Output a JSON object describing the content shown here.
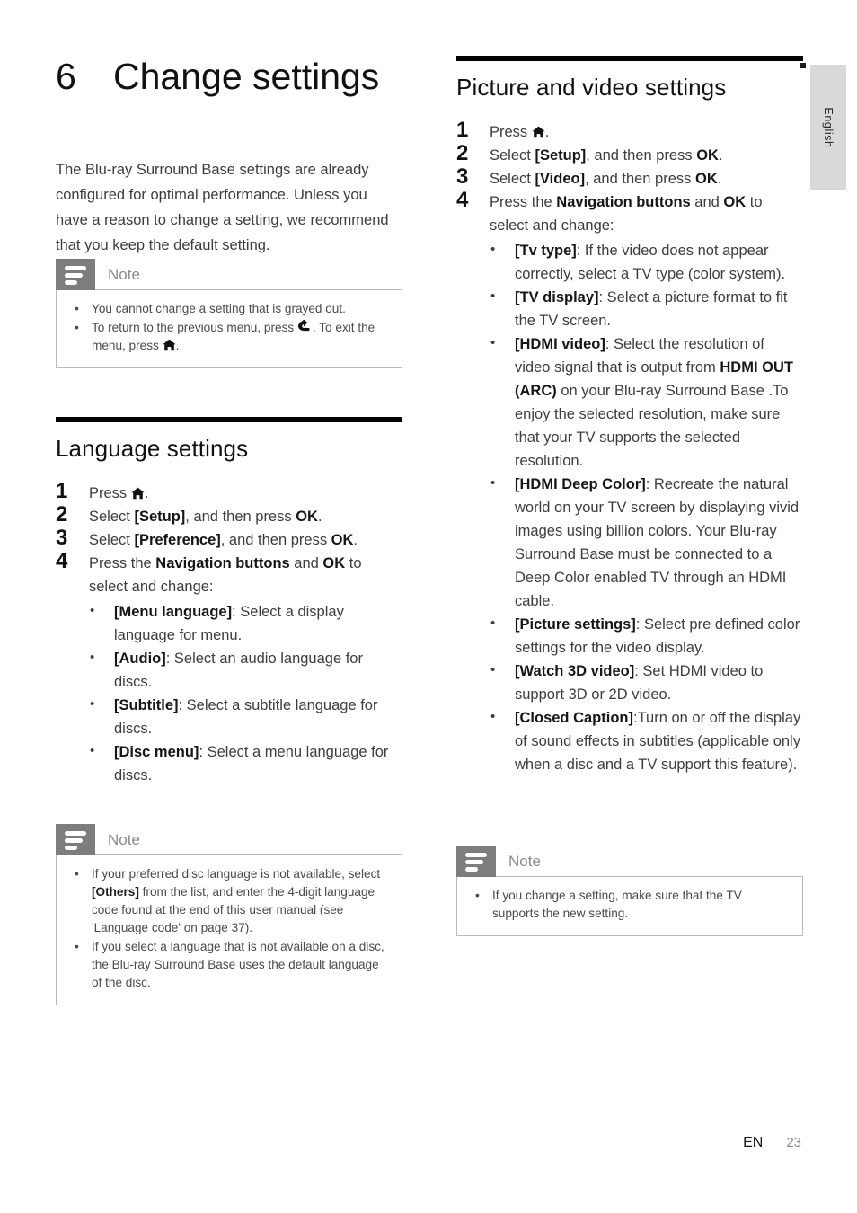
{
  "page": {
    "language_tab": "English",
    "footer_locale": "EN",
    "footer_page_number": "23"
  },
  "chapter": {
    "number": "6",
    "title": "Change settings",
    "intro": "The Blu-ray Surround Base  settings are already configured for optimal performance. Unless you have a reason to change a setting, we recommend that you keep the default setting."
  },
  "note_intro": {
    "label": "Note",
    "items": [
      {
        "pre": "You cannot change a setting that is grayed out.",
        "post": ""
      },
      {
        "pre": "To return to the previous menu, press ",
        "mid": ". To exit the menu, press ",
        "post": "."
      }
    ]
  },
  "language_section": {
    "title": "Language settings",
    "steps": [
      {
        "n": "1",
        "pre": "Press ",
        "post": "."
      },
      {
        "n": "2",
        "pre": "Select ",
        "bold": "[Setup]",
        "mid": ", and then press ",
        "bold2": "OK",
        "post": "."
      },
      {
        "n": "3",
        "pre": "Select ",
        "bold": "[Preference]",
        "mid": ", and then press ",
        "bold2": "OK",
        "post": "."
      },
      {
        "n": "4",
        "pre": "Press the ",
        "bold": "Navigation buttons",
        "mid": " and ",
        "bold2": "OK",
        "post": " to select and change:"
      }
    ],
    "bullets": [
      {
        "term": "[Menu language]",
        "text": ": Select a display language for menu."
      },
      {
        "term": "[Audio]",
        "text": ": Select an audio language for discs."
      },
      {
        "term": "[Subtitle]",
        "text": ": Select a subtitle language for discs."
      },
      {
        "term": "[Disc menu]",
        "text": ": Select a menu language for discs."
      }
    ]
  },
  "note_language": {
    "label": "Note",
    "items": [
      {
        "pre": "If your preferred disc language is not available, select ",
        "bold": "[Others]",
        "post": " from the list, and enter the 4-digit language code found at the end of this user manual (see 'Language code' on page 37)."
      },
      {
        "pre": "If you select a language that is not available on a disc, the Blu-ray Surround Base  uses the default language of the disc.",
        "post": ""
      }
    ]
  },
  "picture_section": {
    "title": "Picture and video settings",
    "steps": [
      {
        "n": "1",
        "pre": "Press ",
        "post": "."
      },
      {
        "n": "2",
        "pre": "Select ",
        "bold": "[Setup]",
        "mid": ", and then press ",
        "bold2": "OK",
        "post": "."
      },
      {
        "n": "3",
        "pre": "Select ",
        "bold": "[Video]",
        "mid": ", and then press ",
        "bold2": "OK",
        "post": "."
      },
      {
        "n": "4",
        "pre": "Press the ",
        "bold": "Navigation buttons",
        "mid": " and ",
        "bold2": "OK",
        "post": " to select and change:"
      }
    ],
    "bullets": [
      {
        "term": "[Tv type]",
        "text": ": If the video does not appear correctly, select a TV type (color system)."
      },
      {
        "term": "[TV display]",
        "text": ": Select a picture format to fit the TV screen."
      },
      {
        "term": "[HDMI video]",
        "text": ": Select the resolution of video signal that is output from ",
        "bold_mid": "HDMI OUT (ARC)",
        "text2": " on your Blu-ray Surround Base .To enjoy the selected resolution, make sure that your TV supports the selected resolution."
      },
      {
        "term": "[HDMI Deep Color]",
        "text": ": Recreate the natural world on your TV screen by displaying vivid images using billion colors. Your Blu-ray Surround Base must be connected to a Deep Color enabled TV through an HDMI cable."
      },
      {
        "term": "[Picture settings]",
        "text": ": Select pre defined color settings for the video display."
      },
      {
        "term": "[Watch 3D video]",
        "text": ": Set HDMI video to support 3D or 2D video."
      },
      {
        "term": "[Closed Caption]",
        "text": ":Turn on or off the display of sound effects in subtitles (applicable only when a disc and a TV support this feature)."
      }
    ]
  },
  "note_picture": {
    "label": "Note",
    "items": [
      {
        "pre": "If you change a setting, make sure that the TV supports the new setting.",
        "post": ""
      }
    ]
  },
  "icons": {
    "home": "home-icon",
    "back": "back-arrow-icon",
    "note": "note-lines-icon"
  },
  "colors": {
    "rule": "#000000",
    "note_badge": "#7d7d7d",
    "note_border": "#b9b9b9",
    "lang_tab": "#d7d9db",
    "body_text": "#3d3d3d"
  }
}
